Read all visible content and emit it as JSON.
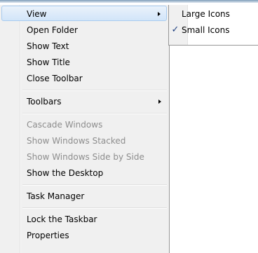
{
  "context_menu": {
    "items": [
      {
        "label": "View",
        "has_submenu": true,
        "state": "highlighted"
      },
      {
        "label": "Open Folder",
        "state": "enabled"
      },
      {
        "label": "Show Text",
        "state": "enabled"
      },
      {
        "label": "Show Title",
        "state": "enabled"
      },
      {
        "label": "Close Toolbar",
        "state": "enabled"
      },
      {
        "label": "Toolbars",
        "has_submenu": true,
        "state": "enabled"
      },
      {
        "label": "Cascade Windows",
        "state": "disabled"
      },
      {
        "label": "Show Windows Stacked",
        "state": "disabled"
      },
      {
        "label": "Show Windows Side by Side",
        "state": "disabled"
      },
      {
        "label": "Show the Desktop",
        "state": "enabled"
      },
      {
        "label": "Task Manager",
        "state": "enabled"
      },
      {
        "label": "Lock the Taskbar",
        "state": "enabled"
      },
      {
        "label": "Properties",
        "state": "enabled"
      }
    ]
  },
  "view_submenu": {
    "items": [
      {
        "label": "Large Icons",
        "checked": false
      },
      {
        "label": "Small Icons",
        "checked": true
      }
    ],
    "check_glyph": "✓"
  },
  "colors": {
    "menu_background": "#f0f0f0",
    "highlight_background": "#d2e5f9",
    "highlight_border": "#a8cbf0",
    "disabled_text": "#8d8d8d",
    "checkmark": "#1e3f80"
  },
  "icons": {
    "submenu_arrow": "chevron-right-icon",
    "checked": "checkmark-icon"
  }
}
